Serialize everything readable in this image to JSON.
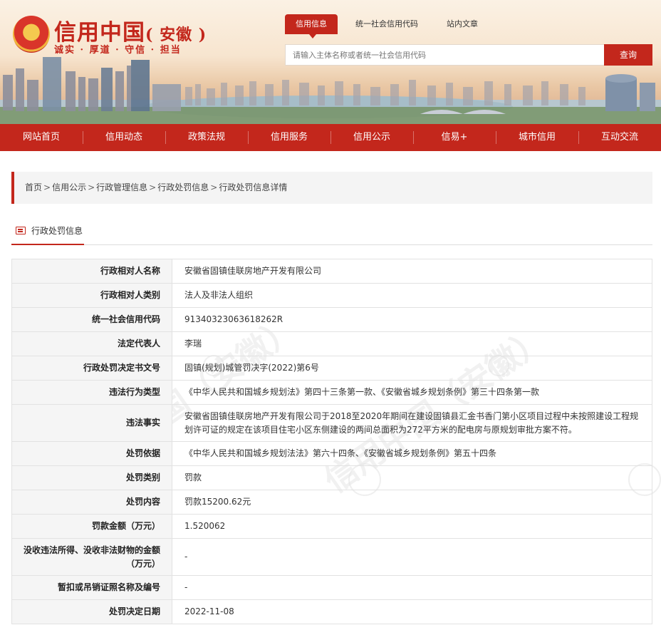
{
  "header": {
    "title_main": "信用中国",
    "title_region": "( 安徽 )",
    "slogan": "诚实 · 厚道 · 守信 · 担当",
    "tabs": [
      "信用信息",
      "统一社会信用代码",
      "站内文章"
    ],
    "active_tab": "信用信息",
    "search": {
      "placeholder": "请输入主体名称或者统一社会信用代码",
      "button": "查询"
    },
    "emblem_icon": "national-emblem-icon"
  },
  "nav": {
    "items": [
      "网站首页",
      "信用动态",
      "政策法规",
      "信用服务",
      "信用公示",
      "信易+",
      "城市信用",
      "互动交流"
    ]
  },
  "breadcrumb": [
    "首页",
    "信用公示",
    "行政管理信息",
    "行政处罚信息",
    "行政处罚信息详情"
  ],
  "breadcrumb_sep": ">",
  "section": {
    "title": "行政处罚信息",
    "icon": "document-icon"
  },
  "watermark_text": "信用中国（安徽）",
  "rows": [
    {
      "label": "行政相对人名称",
      "value": "安徽省固镇佳联房地产开发有限公司"
    },
    {
      "label": "行政相对人类别",
      "value": "法人及非法人组织"
    },
    {
      "label": "统一社会信用代码",
      "value": "91340323063618262R"
    },
    {
      "label": "法定代表人",
      "value": "李瑞"
    },
    {
      "label": "行政处罚决定书文号",
      "value": "固镇(规划)城管罚决字(2022)第6号"
    },
    {
      "label": "违法行为类型",
      "value": "《中华人民共和国城乡规划法》第四十三条第一款、《安徽省城乡规划条例》第三十四条第一款"
    },
    {
      "label": "违法事实",
      "value": "安徽省固镇佳联房地产开发有限公司于2018至2020年期间在建设固镇县汇金书香门第小区项目过程中未按照建设工程规划许可证的规定在该项目住宅小区东侧建设的两间总面积为272平方米的配电房与原规划审批方案不符。"
    },
    {
      "label": "处罚依据",
      "value": "《中华人民共和国城乡规划法法》第六十四条、《安徽省城乡规划条例》第五十四条"
    },
    {
      "label": "处罚类别",
      "value": "罚款"
    },
    {
      "label": "处罚内容",
      "value": "罚款15200.62元"
    },
    {
      "label": "罚款金额（万元）",
      "value": "1.520062"
    },
    {
      "label": "没收违法所得、没收非法财物的金额（万元）",
      "value": "-"
    },
    {
      "label": "暂扣或吊销证照名称及编号",
      "value": "-"
    },
    {
      "label": "处罚决定日期",
      "value": "2022-11-08"
    }
  ],
  "colors": {
    "brand_red": "#c3271c",
    "label_bg": "#f5f5f5",
    "border": "#e2e2e2"
  }
}
